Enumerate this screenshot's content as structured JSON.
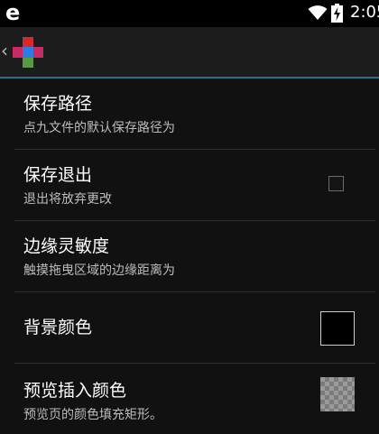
{
  "status_bar": {
    "left_icon": "e",
    "left_icon_name": "browser-e-icon",
    "wifi_icon": "wifi-icon",
    "battery_icon": "battery-charging-icon",
    "time": "2:05"
  },
  "action_bar": {
    "back_glyph": "‹",
    "logo_icon": "nine-patch-logo-icon",
    "accent_color": "#2a6e8e"
  },
  "preferences": [
    {
      "title": "保存路径",
      "summary": "点九文件的默认保存路径为"
    },
    {
      "title": "保存退出",
      "summary": "退出将放弃更改",
      "widget": "checkbox",
      "checked": false
    },
    {
      "title": "边缘灵敏度",
      "summary": "触摸拖曳区域的边缘距离为"
    },
    {
      "title": "背景颜色",
      "summary": "",
      "widget": "color-swatch",
      "color": "#000000"
    },
    {
      "title": "预览插入颜色",
      "summary": "预览页的颜色填充矩形。",
      "widget": "color-swatch",
      "color": "transparent-checker"
    }
  ]
}
